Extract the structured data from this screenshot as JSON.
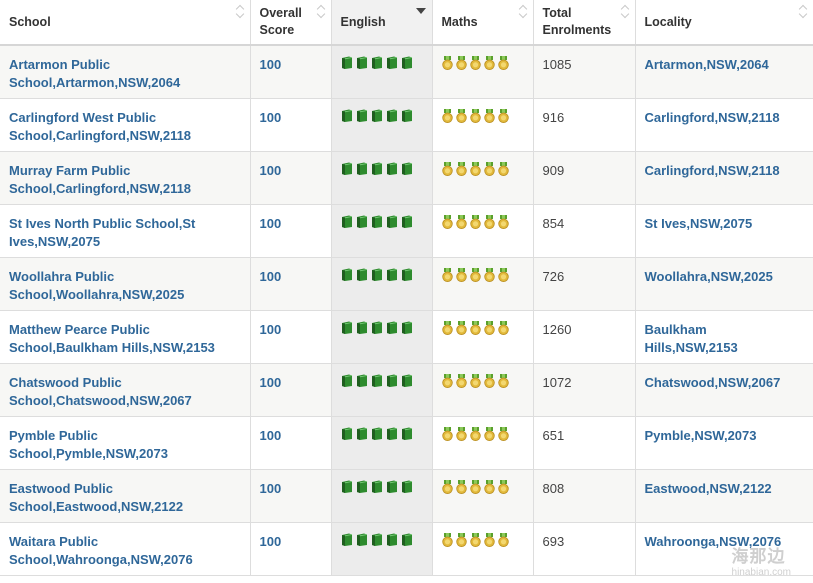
{
  "headers": {
    "school": "School",
    "score": "Overall Score",
    "english": "English",
    "maths": "Maths",
    "enrolments": "Total Enrolments",
    "locality": "Locality"
  },
  "sorted_column": "English",
  "rows": [
    {
      "school": "Artarmon Public School,Artarmon,NSW,2064",
      "score": "100",
      "english_rating": 5,
      "maths_rating": 5,
      "enrolments": "1085",
      "locality": "Artarmon,NSW,2064"
    },
    {
      "school": "Carlingford West Public School,Carlingford,NSW,2118",
      "score": "100",
      "english_rating": 5,
      "maths_rating": 5,
      "enrolments": "916",
      "locality": "Carlingford,NSW,2118"
    },
    {
      "school": "Murray Farm Public School,Carlingford,NSW,2118",
      "score": "100",
      "english_rating": 5,
      "maths_rating": 5,
      "enrolments": "909",
      "locality": "Carlingford,NSW,2118"
    },
    {
      "school": "St Ives North Public School,St Ives,NSW,2075",
      "score": "100",
      "english_rating": 5,
      "maths_rating": 5,
      "enrolments": "854",
      "locality": "St Ives,NSW,2075"
    },
    {
      "school": "Woollahra Public School,Woollahra,NSW,2025",
      "score": "100",
      "english_rating": 5,
      "maths_rating": 5,
      "enrolments": "726",
      "locality": "Woollahra,NSW,2025"
    },
    {
      "school": "Matthew Pearce Public School,Baulkham Hills,NSW,2153",
      "score": "100",
      "english_rating": 5,
      "maths_rating": 5,
      "enrolments": "1260",
      "locality": "Baulkham Hills,NSW,2153"
    },
    {
      "school": "Chatswood Public School,Chatswood,NSW,2067",
      "score": "100",
      "english_rating": 5,
      "maths_rating": 5,
      "enrolments": "1072",
      "locality": "Chatswood,NSW,2067"
    },
    {
      "school": "Pymble Public School,Pymble,NSW,2073",
      "score": "100",
      "english_rating": 5,
      "maths_rating": 5,
      "enrolments": "651",
      "locality": "Pymble,NSW,2073"
    },
    {
      "school": "Eastwood Public School,Eastwood,NSW,2122",
      "score": "100",
      "english_rating": 5,
      "maths_rating": 5,
      "enrolments": "808",
      "locality": "Eastwood,NSW,2122"
    },
    {
      "school": "Waitara Public School,Wahroonga,NSW,2076",
      "score": "100",
      "english_rating": 5,
      "maths_rating": 5,
      "enrolments": "693",
      "locality": "Wahroonga,NSW,2076"
    }
  ],
  "icons": {
    "english": "book-icon",
    "maths": "medal-icon"
  },
  "colors": {
    "link": "#2f6799",
    "book": "#2e8b2e",
    "medal": "#e2b93b",
    "medal_ribbon": "#5aa02c"
  },
  "watermark": {
    "text": "海那边",
    "sub": "hinabian.com"
  }
}
